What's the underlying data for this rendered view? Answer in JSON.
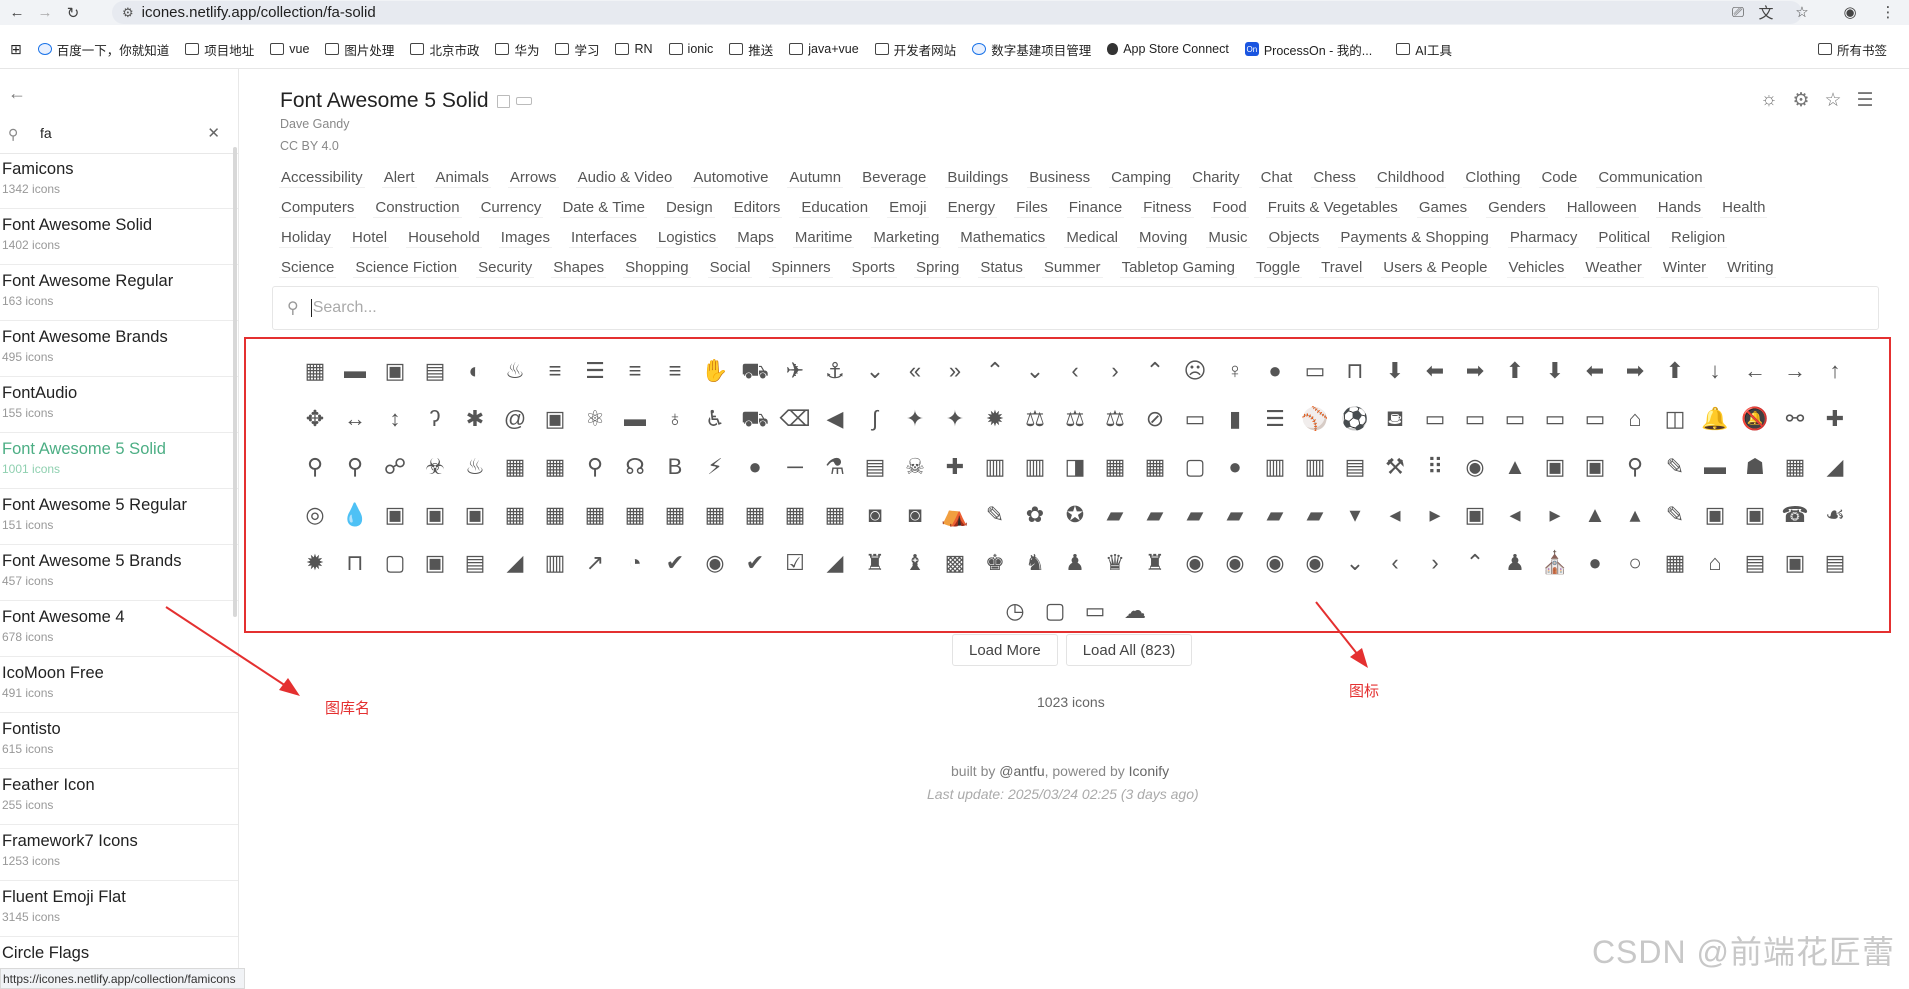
{
  "browser": {
    "url": "icones.netlify.app/collection/fa-solid",
    "status_url": "https://icones.netlify.app/collection/famicons",
    "bookmarks": [
      "百度一下，你就知道",
      "项目地址",
      "vue",
      "图片处理",
      "北京市政",
      "华为",
      "学习",
      "RN",
      "ionic",
      "推送",
      "java+vue",
      "开发者网站",
      "数字基建项目管理",
      "App Store Connect",
      "ProcessOn - 我的...",
      "AI工具"
    ],
    "bookmarks_right": "所有书签"
  },
  "sidebar": {
    "search_value": "fa",
    "items": [
      {
        "name": "Famicons",
        "count": "1342 icons"
      },
      {
        "name": "Font Awesome Solid",
        "count": "1402 icons"
      },
      {
        "name": "Font Awesome Regular",
        "count": "163 icons"
      },
      {
        "name": "Font Awesome Brands",
        "count": "495 icons"
      },
      {
        "name": "FontAudio",
        "count": "155 icons"
      },
      {
        "name": "Font Awesome 5 Solid",
        "count": "1001 icons"
      },
      {
        "name": "Font Awesome 5 Regular",
        "count": "151 icons"
      },
      {
        "name": "Font Awesome 5 Brands",
        "count": "457 icons"
      },
      {
        "name": "Font Awesome 4",
        "count": "678 icons"
      },
      {
        "name": "IcoMoon Free",
        "count": "491 icons"
      },
      {
        "name": "Fontisto",
        "count": "615 icons"
      },
      {
        "name": "Feather Icon",
        "count": "255 icons"
      },
      {
        "name": "Framework7 Icons",
        "count": "1253 icons"
      },
      {
        "name": "Fluent Emoji Flat",
        "count": "3145 icons"
      },
      {
        "name": "Circle Flags",
        "count": ""
      }
    ]
  },
  "collection": {
    "title": "Font Awesome 5 Solid",
    "author": "Dave Gandy",
    "license": "CC BY 4.0"
  },
  "categories": [
    [
      "Accessibility",
      "Alert",
      "Animals",
      "Arrows",
      "Audio & Video",
      "Automotive",
      "Autumn",
      "Beverage",
      "Buildings",
      "Business",
      "Camping",
      "Charity",
      "Chat",
      "Chess",
      "Childhood",
      "Clothing",
      "Code",
      "Communication"
    ],
    [
      "Computers",
      "Construction",
      "Currency",
      "Date & Time",
      "Design",
      "Editors",
      "Education",
      "Emoji",
      "Energy",
      "Files",
      "Finance",
      "Fitness",
      "Food",
      "Fruits & Vegetables",
      "Games",
      "Genders",
      "Halloween",
      "Hands",
      "Health"
    ],
    [
      "Holiday",
      "Hotel",
      "Household",
      "Images",
      "Interfaces",
      "Logistics",
      "Maps",
      "Maritime",
      "Marketing",
      "Mathematics",
      "Medical",
      "Moving",
      "Music",
      "Objects",
      "Payments & Shopping",
      "Pharmacy",
      "Political",
      "Religion"
    ],
    [
      "Science",
      "Science Fiction",
      "Security",
      "Shapes",
      "Shopping",
      "Social",
      "Spinners",
      "Sports",
      "Spring",
      "Status",
      "Summer",
      "Tabletop Gaming",
      "Toggle",
      "Travel",
      "Users & People",
      "Vehicles",
      "Weather",
      "Winter",
      "Writing"
    ]
  ],
  "search": {
    "placeholder": "Search..."
  },
  "icons": [
    "▦",
    "▬",
    "▣",
    "▤",
    "◐",
    "♨",
    "≡",
    "☰",
    "≡",
    "≡",
    "✋",
    "⛟",
    "✈",
    "⚓",
    "⌄",
    "«",
    "»",
    "⌃",
    "⌄",
    "‹",
    "›",
    "⌃",
    "☹",
    "♀",
    "●",
    "▭",
    "⊓",
    "⬇",
    "⬅",
    "➡",
    "⬆",
    "⬇",
    "⬅",
    "➡",
    "⬆",
    "↓",
    "←",
    "→",
    "↑",
    "✥",
    "↔",
    "↕",
    "ʔ",
    "✱",
    "@",
    "▣",
    "⚛",
    "▬",
    "♁",
    "♿",
    "⛟",
    "⌫",
    "◀",
    "∫",
    "✦",
    "✦",
    "✹",
    "⚖",
    "⚖",
    "⚖",
    "⊘",
    "▭",
    "▮",
    "☰",
    "⚾",
    "⚽",
    "⛾",
    "▭",
    "▭",
    "▭",
    "▭",
    "▭",
    "⌂",
    "◫",
    "🔔",
    "🔕",
    "⚯",
    "✚",
    "⚲",
    "⚲",
    "☍",
    "☣",
    "♨",
    "▦",
    "▦",
    "⚲",
    "☊",
    "B",
    "⚡",
    "●",
    "─",
    "⚗",
    "▤",
    "☠",
    "✚",
    "▥",
    "▥",
    "◨",
    "▦",
    "▦",
    "▢",
    "●",
    "▥",
    "▥",
    "▤",
    "⚒",
    "⠿",
    "◉",
    "▲",
    "▣",
    "▣",
    "⚲",
    "✎",
    "▬",
    "☗",
    "▦",
    "◢",
    "◎",
    "💧",
    "▣",
    "▣",
    "▣",
    "▦",
    "▦",
    "▦",
    "▦",
    "▦",
    "▦",
    "▦",
    "▦",
    "▦",
    "◙",
    "◙",
    "⛺",
    "✎",
    "✿",
    "✪",
    "▰",
    "▰",
    "▰",
    "▰",
    "▰",
    "▰",
    "▾",
    "◂",
    "▸",
    "▣",
    "◂",
    "▸",
    "▲",
    "▴",
    "✎",
    "▣",
    "▣",
    "☎",
    "☙",
    "✹",
    "⊓",
    "▢",
    "▣",
    "▤",
    "◢",
    "▥",
    "↗",
    "◔",
    "✔",
    "◉",
    "✔",
    "☑",
    "◢",
    "♜",
    "♝",
    "▩",
    "♚",
    "♞",
    "♟",
    "♛",
    "♜",
    "◉",
    "◉",
    "◉",
    "◉",
    "⌄",
    "‹",
    "›",
    "⌃",
    "♟",
    "⛪",
    "●",
    "○",
    "▦",
    "⌂",
    "▤",
    "▣",
    "▤",
    "◷",
    "▢",
    "▭",
    "☁"
  ],
  "actions": {
    "load_more": "Load More",
    "load_all": "Load All (823)"
  },
  "footer": {
    "count": "1023 icons",
    "built_prefix": "built by ",
    "built_by": "@antfu",
    "powered_prefix": ", powered by ",
    "powered_by": "Iconify",
    "last_update": "Last update: 2025/03/24 02:25 (3 days ago)"
  },
  "annotations": {
    "library_name": "图库名",
    "icons": "图标"
  },
  "watermark": "CSDN @前端花匠蕾"
}
